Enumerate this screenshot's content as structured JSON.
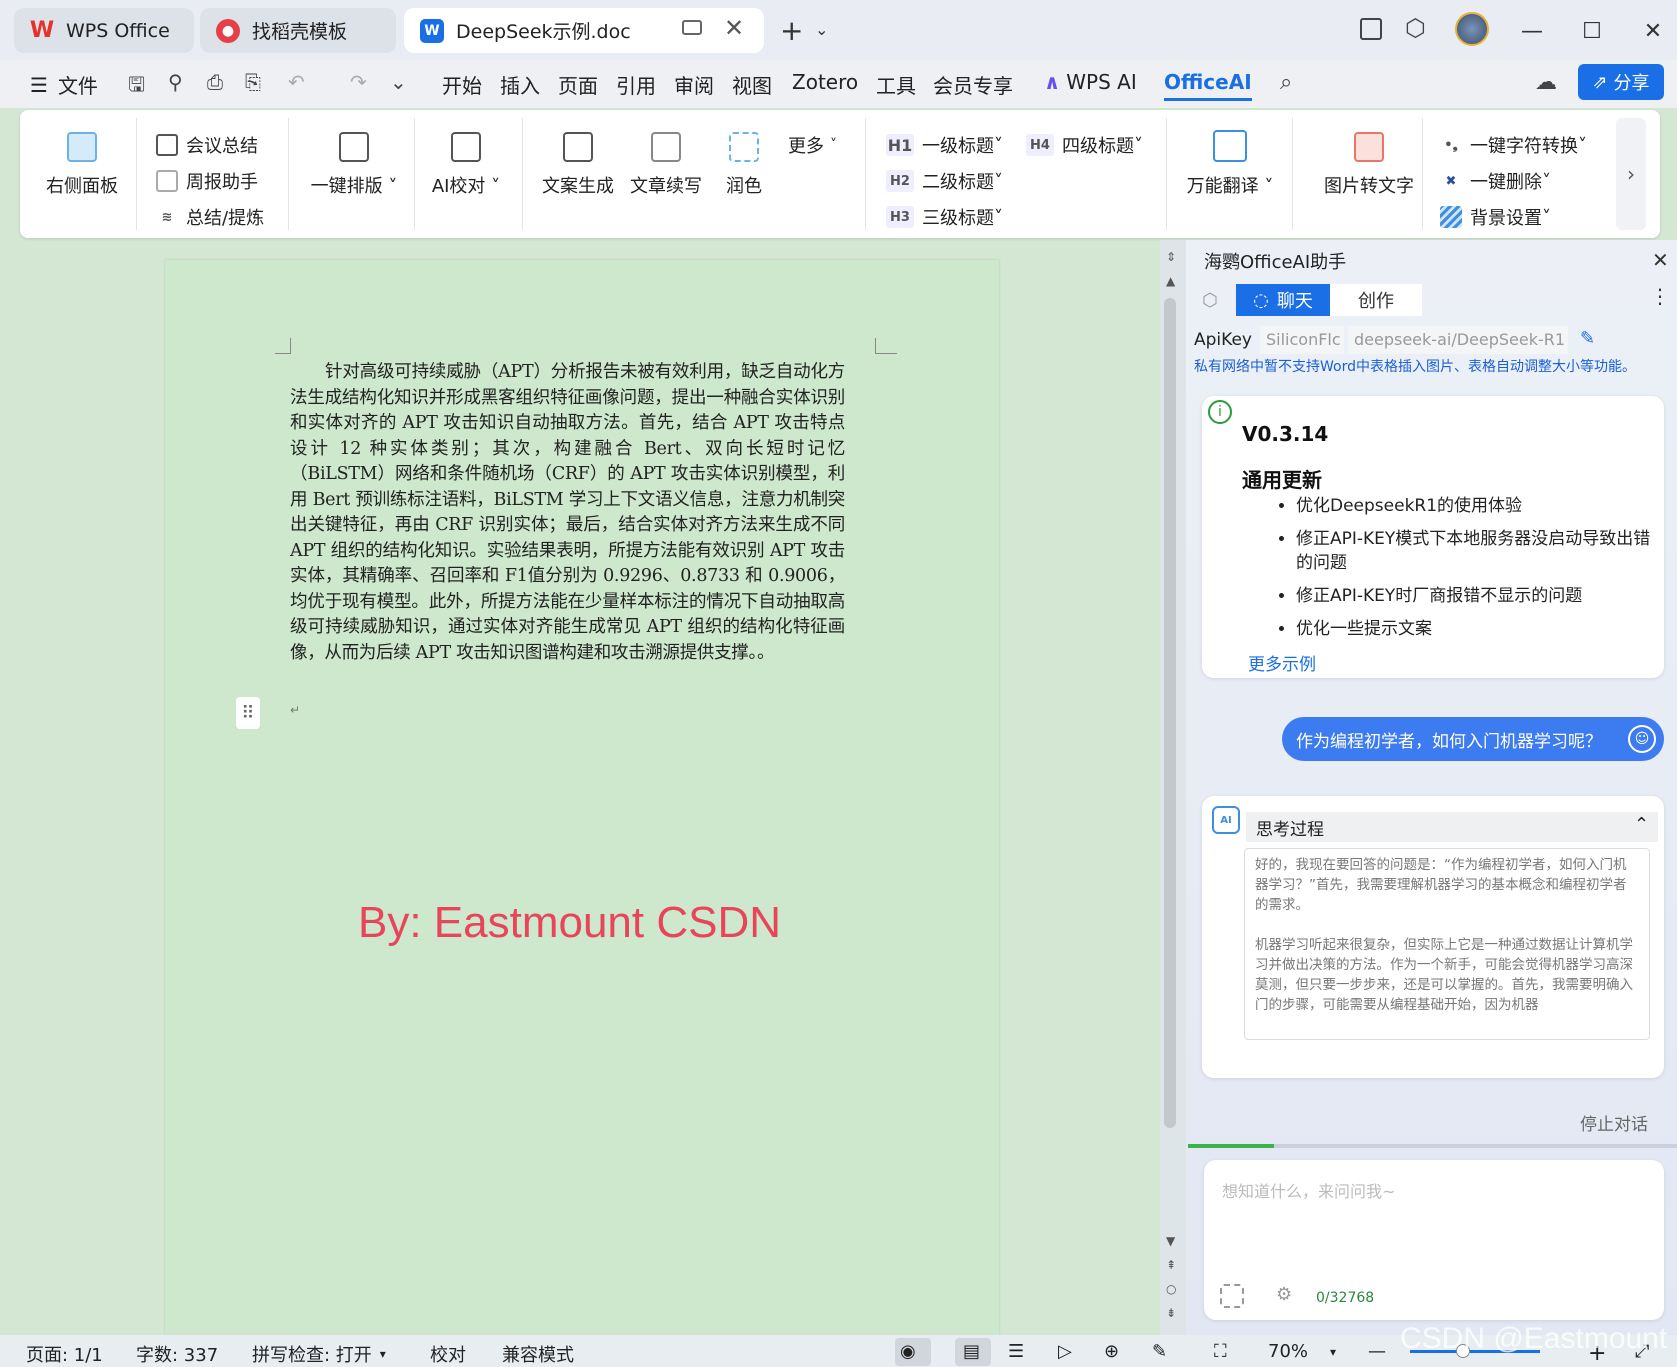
{
  "tabs": [
    {
      "label": "WPS Office"
    },
    {
      "label": "找稻壳模板"
    },
    {
      "label": "DeepSeek示例.doc"
    }
  ],
  "menu": {
    "file": "文件",
    "items": [
      "开始",
      "插入",
      "页面",
      "引用",
      "审阅",
      "视图",
      "Zotero",
      "工具",
      "会员专享"
    ],
    "wps_ai": "WPS AI",
    "office_ai": "OfficeAI",
    "share": "分享"
  },
  "ribbon": {
    "right_panel": "右侧面板",
    "meeting_summary": "会议总结",
    "weekly_helper": "周报助手",
    "summary": "总结/提炼",
    "one_click_layout": "一键排版",
    "ai_proofread": "AI校对",
    "copy_gen": "文案生成",
    "continue_write": "文章续写",
    "polish": "润色",
    "more": "更多",
    "h1": "一级标题",
    "h2": "二级标题",
    "h3": "三级标题",
    "h4": "四级标题",
    "translate": "万能翻译",
    "img_to_text": "图片转文字",
    "char_convert": "一键字符转换",
    "one_click_delete": "一键删除",
    "bg_settings": "背景设置"
  },
  "document": {
    "paragraph": "针对高级可持续威胁（APT）分析报告未被有效利用，缺乏自动化方法生成结构化知识并形成黑客组织特征画像问题，提出一种融合实体识别和实体对齐的 APT 攻击知识自动抽取方法。首先，结合 APT 攻击特点设计 12 种实体类别；其次，构建融合 Bert、双向长短时记忆（BiLSTM）网络和条件随机场（CRF）的 APT 攻击实体识别模型，利用 Bert 预训练标注语料，BiLSTM 学习上下文语义信息，注意力机制突出关键特征，再由 CRF 识别实体；最后，结合实体对齐方法来生成不同 APT 组织的结构化知识。实验结果表明，所提方法能有效识别 APT 攻击实体，其精确率、召回率和 F1值分别为 0.9296、0.8733 和 0.9006，均优于现有模型。此外，所提方法能在少量样本标注的情况下自动抽取高级可持续威胁知识，通过实体对齐能生成常见 APT 组织的结构化特征画像，从而为后续 APT 攻击知识图谱构建和攻击溯源提供支撑。。",
    "empty_para_mark": "↵",
    "watermark": "By: Eastmount CSDN"
  },
  "panel": {
    "title": "海鹦OfficeAI助手",
    "tab_chat": "聊天",
    "tab_create": "创作",
    "apikey_label": "ApiKey",
    "provider": "SiliconFlc",
    "model": "deepseek-ai/DeepSeek-R1",
    "notice": "私有网络中暂不支持Word中表格插入图片、表格自动调整大小等功能。",
    "update_card": {
      "version": "V0.3.14",
      "heading": "通用更新",
      "items": [
        "优化DeepseekR1的使用体验",
        "修正API-KEY模式下本地服务器没启动导致出错的问题",
        "修正API-KEY时厂商报错不显示的问题",
        "优化一些提示文案"
      ],
      "more_link": "更多示例"
    },
    "user_message": "作为编程初学者，如何入门机器学习呢？",
    "thinking_title": "思考过程",
    "thinking_p1": "好的，我现在要回答的问题是：“作为编程初学者，如何入门机器学习？”首先，我需要理解机器学习的基本概念和编程初学者的需求。",
    "thinking_p2": "机器学习听起来很复杂，但实际上它是一种通过数据让计算机学习并做出决策的方法。作为一个新手，可能会觉得机器学习高深莫测，但只要一步步来，还是可以掌握的。首先，我需要明确入门的步骤，可能需要从编程基础开始，因为机器",
    "stop": "停止对话",
    "input_placeholder": "想知道什么，来问问我~",
    "char_count": "0/32768"
  },
  "status": {
    "page": "页面: 1/1",
    "words": "字数: 337",
    "spell": "拼写检查: 打开",
    "proof": "校对",
    "compat": "兼容模式",
    "zoom": "70%",
    "watermark": "CSDN @Eastmount"
  },
  "colors": {
    "accent": "#1a6fe6",
    "doc_bg": "#cde8cc",
    "watermark_red": "#e8455a"
  }
}
